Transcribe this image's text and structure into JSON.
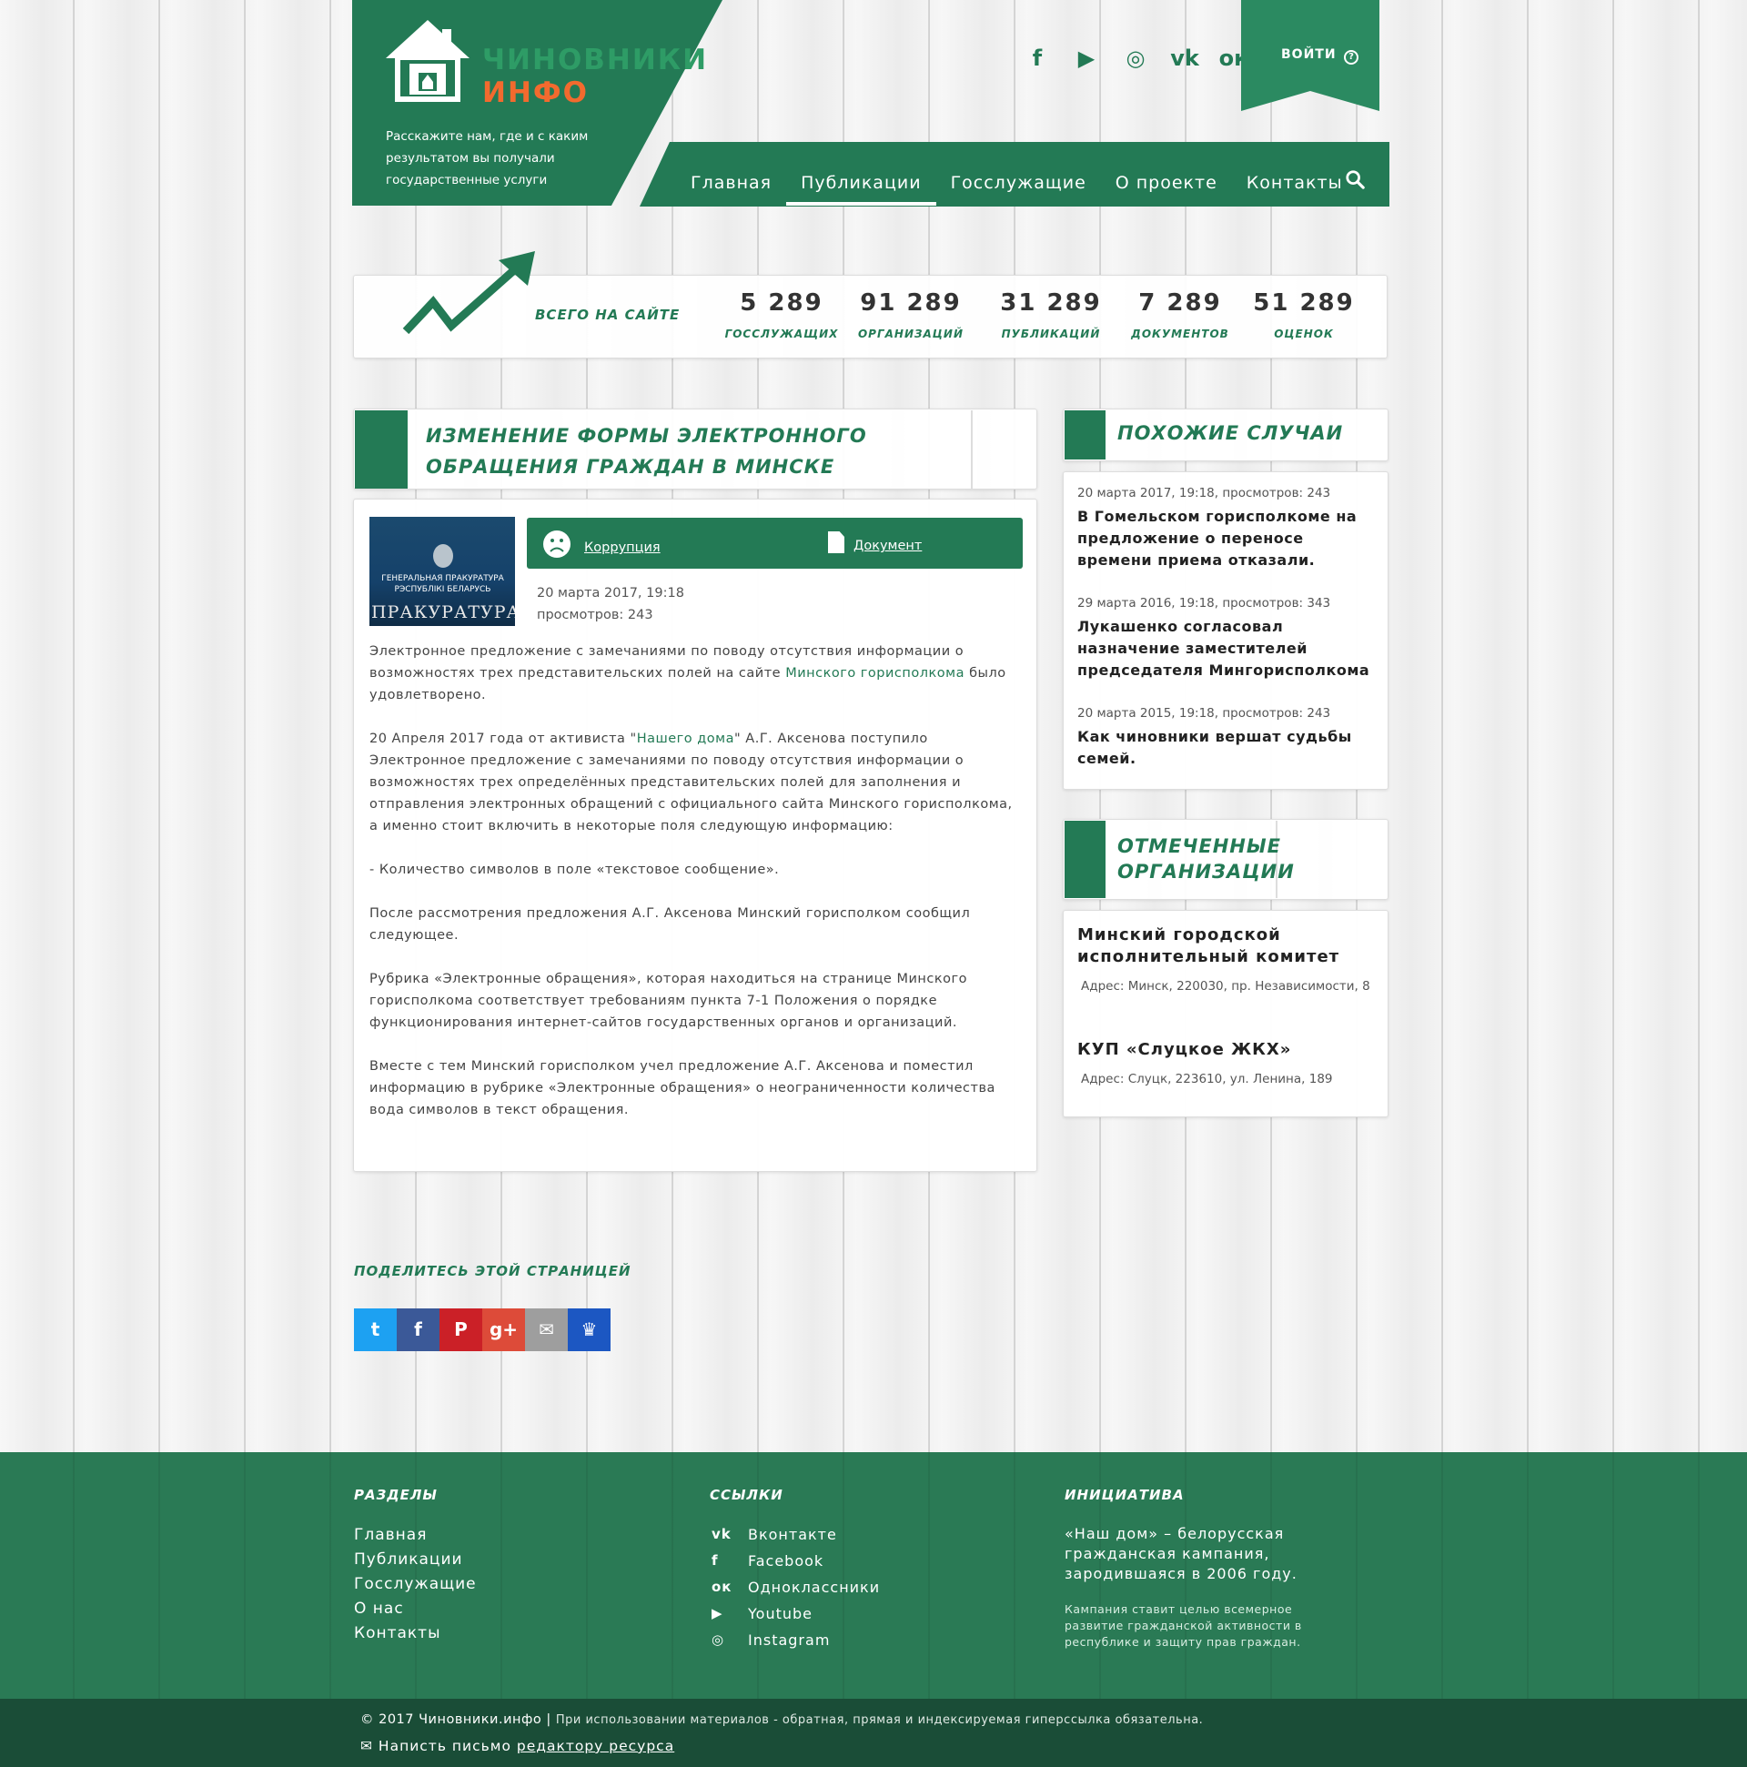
{
  "header": {
    "logo_line1": "ЧИНОВНИКИ",
    "logo_line2": "ИНФО",
    "tagline": "Расскажите нам, где и с каким результатом вы получали государственные услуги",
    "login_label": "ВОЙТИ",
    "help_glyph": "?",
    "socials": [
      {
        "icon": "facebook-icon",
        "glyph": "f"
      },
      {
        "icon": "youtube-icon",
        "glyph": "▶"
      },
      {
        "icon": "instagram-icon",
        "glyph": "◎"
      },
      {
        "icon": "vk-icon",
        "glyph": "vk"
      },
      {
        "icon": "odnoklassniki-icon",
        "glyph": "ок"
      }
    ],
    "colors": {
      "green": "#237a55",
      "orange": "#f26a2e",
      "dark_green": "#1a4d37"
    }
  },
  "nav": {
    "items": [
      "Главная",
      "Публикации",
      "Госслужащие",
      "О проекте",
      "Контакты"
    ],
    "active": "Публикации"
  },
  "stats": {
    "label": "ВСЕГО НА САЙТЕ",
    "items": [
      {
        "value": "5 289",
        "label": "ГОССЛУЖАЩИХ"
      },
      {
        "value": "91 289",
        "label": "ОРГАНИЗАЦИЙ"
      },
      {
        "value": "31 289",
        "label": "ПУБЛИКАЦИЙ"
      },
      {
        "value": "7 289",
        "label": "ДОКУМЕНТОВ"
      },
      {
        "value": "51 289",
        "label": "ОЦЕНОК"
      }
    ]
  },
  "article": {
    "title": "ИЗМЕНЕНИЕ ФОРМЫ ЭЛЕКТРОННОГО ОБРАЩЕНИЯ ГРАЖДАН В МИНСКЕ",
    "image_caption": "ГЕНЕРАЛЬНАЯ ПРАКУРАТУРА РЭСПУБЛІКІ БЕЛАРУСЬ",
    "image_word": "ПРАКУРАТУРА",
    "category": "Коррупция",
    "doc_link": "Документ",
    "date": "20 марта 2017, 19:18",
    "views": "просмотров: 243",
    "p1_before": "Электронное предложение с замечаниями по поводу отсутствия информации о возможностях трех представительских полей на сайте ",
    "p1_link": "Минского горисполкома",
    "p1_after": " было удовлетворено.",
    "p2_before": "20 Апреля 2017 года от активиста \"",
    "p2_link": "Нашего дома",
    "p2_after": "\" А.Г. Аксенова поступило Электронное предложение с замечаниями по поводу отсутствия информации о возможностях трех определённых представительских полей для заполнения и отправления электронных обращений с официального сайта Минского горисполкома, а именно стоит включить в некоторые поля следующую информацию:",
    "p3": "- Количество символов в поле «текстовое сообщение».",
    "p4": "После рассмотрения предложения   А.Г. Аксенова Минский горисполком сообщил следующее.",
    "p5": "Рубрика  «Электронные обращения», которая находиться на странице  Минского горисполкома соответствует требованиям пункта 7-1 Положения о порядке функционирования  интернет-сайтов государственных органов и организаций.",
    "p6": "Вместе с тем Минский горисполком учел предложение А.Г. Аксенова и поместил информацию в рубрике «Электронные обращения» о неограниченности количества вода символов в текст обращения."
  },
  "similar": {
    "title": "ПОХОЖИЕ СЛУЧАИ",
    "items": [
      {
        "meta": "20 марта 2017, 19:18, просмотров: 243",
        "title": "В Гомельском горисполкоме на предложение о переносе времени приема отказали."
      },
      {
        "meta": "29 марта 2016, 19:18, просмотров: 343",
        "title": "Лукашенко согласовал назначение заместителей председателя Мингорисполкома"
      },
      {
        "meta": "20 марта 2015, 19:18, просмотров: 243",
        "title": "Как чиновники вершат судьбы семей."
      }
    ]
  },
  "orgs": {
    "title_line1": "ОТМЕЧЕННЫЕ",
    "title_line2": "ОРГАНИЗАЦИИ",
    "items": [
      {
        "name": "Минский городской исполнительный комитет",
        "addr": "Адрес: Минск, 220030, пр. Независимости, 8"
      },
      {
        "name": "КУП «Слуцкое ЖКХ»",
        "addr": "Адрес: Слуцк, 223610, ул. Ленина, 189"
      }
    ]
  },
  "share": {
    "label": "ПОДЕЛИТЕСЬ ЭТОЙ СТРАНИЦЕЙ",
    "buttons": [
      {
        "icon": "twitter-icon",
        "glyph": "t",
        "color": "#1da1f2"
      },
      {
        "icon": "facebook-icon",
        "glyph": "f",
        "color": "#3b5998"
      },
      {
        "icon": "pinterest-icon",
        "glyph": "P",
        "color": "#cb2027"
      },
      {
        "icon": "googleplus-icon",
        "glyph": "g+",
        "color": "#dd4b39"
      },
      {
        "icon": "email-icon",
        "glyph": "✉",
        "color": "#9e9e9e"
      },
      {
        "icon": "crown-icon",
        "glyph": "♛",
        "color": "#1c57c2"
      }
    ]
  },
  "footer": {
    "sections_title": "РАЗДЕЛЫ",
    "sections": [
      "Главная",
      "Публикации",
      "Госслужащие",
      "О нас",
      "Контакты"
    ],
    "links_title": "ССЫЛКИ",
    "links": [
      {
        "icon": "vk-icon",
        "glyph": "vk",
        "label": "Вконтакте"
      },
      {
        "icon": "facebook-icon",
        "glyph": "f",
        "label": "Facebook"
      },
      {
        "icon": "odnoklassniki-icon",
        "glyph": "ок",
        "label": "Одноклассники"
      },
      {
        "icon": "youtube-icon",
        "glyph": "▶",
        "label": "Youtube"
      },
      {
        "icon": "instagram-icon",
        "glyph": "◎",
        "label": "Instagram"
      }
    ],
    "initiative_title": "ИНИЦИАТИВА",
    "initiative_text": "«Наш дом» – белорусская гражданская кампания, зародившаяся в 2006 году.",
    "initiative_small": "Кампания ставит целью всемерное развитие гражданской активности в республике и защиту прав граждан.",
    "copyright": "© 2017 Чиновники.инфо | ",
    "copyright_note": "При использовании материалов - обратная, прямая и индексируемая гиперссылка обязательна.",
    "mail_text": "Написть письмо ",
    "mail_link": "редактору ресурса"
  }
}
